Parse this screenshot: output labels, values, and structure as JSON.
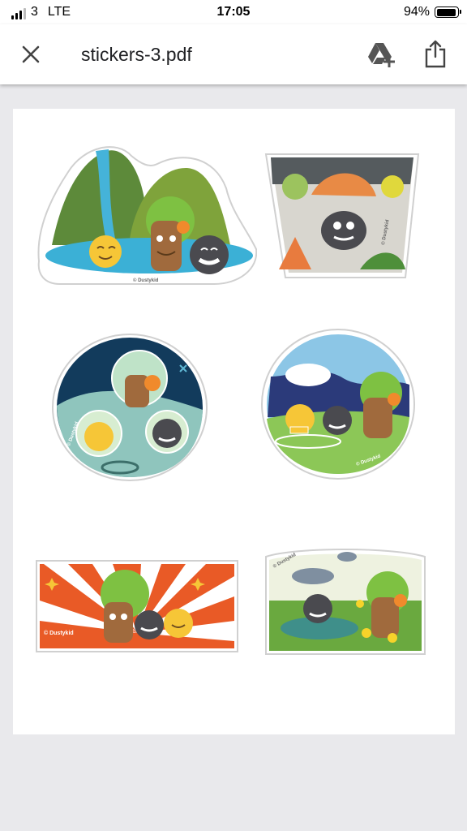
{
  "status": {
    "carrier": "3",
    "network": "LTE",
    "time": "17:05",
    "battery": "94%",
    "battery_level": 0.94
  },
  "toolbar": {
    "title": "stickers-3.pdf",
    "close_icon": "close-icon",
    "drive_icon": "add-to-drive-icon",
    "share_icon": "share-icon"
  },
  "stickers": {
    "credit": "© Dustykid"
  }
}
